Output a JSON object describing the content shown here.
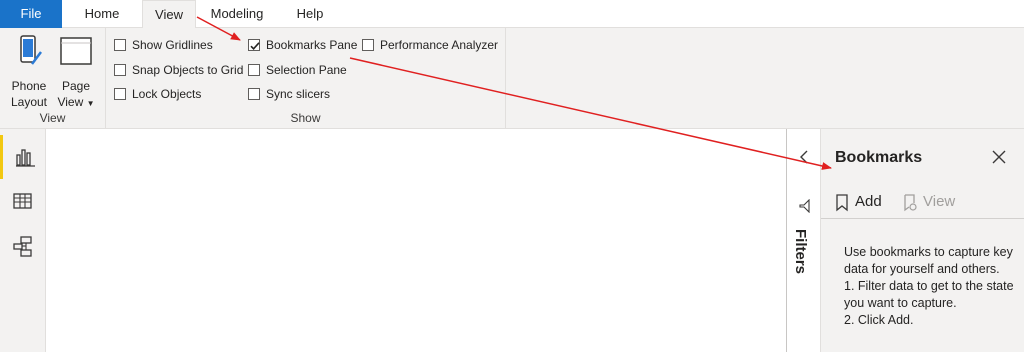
{
  "tabs": {
    "file": "File",
    "home": "Home",
    "view": "View",
    "modeling": "Modeling",
    "help": "Help"
  },
  "ribbon": {
    "view_group": {
      "label": "View",
      "phone_layout": {
        "line1": "Phone",
        "line2": "Layout"
      },
      "page_view": {
        "line1": "Page",
        "line2": "View"
      }
    },
    "show_group": {
      "label": "Show",
      "show_gridlines": {
        "label": "Show Gridlines",
        "checked": false
      },
      "snap_to_grid": {
        "label": "Snap Objects to Grid",
        "checked": false
      },
      "lock_objects": {
        "label": "Lock Objects",
        "checked": false
      },
      "bookmarks_pane": {
        "label": "Bookmarks Pane",
        "checked": true
      },
      "selection_pane": {
        "label": "Selection Pane",
        "checked": false
      },
      "sync_slicers": {
        "label": "Sync slicers",
        "checked": false
      },
      "performance_analyzer": {
        "label": "Performance Analyzer",
        "checked": false
      }
    }
  },
  "leftnav": {
    "items": [
      {
        "icon": "report-icon",
        "active": true
      },
      {
        "icon": "data-icon",
        "active": false
      },
      {
        "icon": "model-icon",
        "active": false
      }
    ]
  },
  "filters": {
    "label": "Filters"
  },
  "bookmarks": {
    "title": "Bookmarks",
    "add_label": "Add",
    "view_label": "View",
    "help_lines": [
      "Use bookmarks to capture key data for yourself and others.",
      "1. Filter data to get to the state you want to capture.",
      "2. Click Add."
    ]
  },
  "colors": {
    "accent_file": "#1a73c9",
    "active_nav": "#f2c811",
    "annotation_arrow": "#e02020"
  }
}
